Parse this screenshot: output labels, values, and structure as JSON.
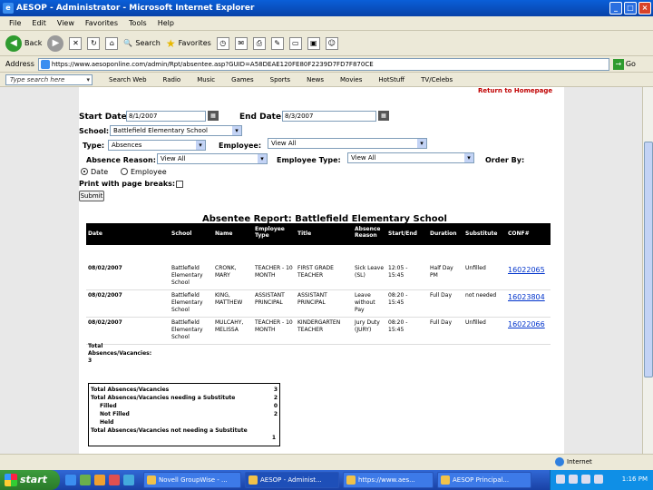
{
  "window": {
    "title": "AESOP - Administrator - Microsoft Internet Explorer"
  },
  "menu": [
    "File",
    "Edit",
    "View",
    "Favorites",
    "Tools",
    "Help"
  ],
  "toolbar": {
    "back": "Back",
    "search": "Search",
    "favorites": "Favorites"
  },
  "address": {
    "label": "Address",
    "url": "https://www.aesoponline.com/admin/Rpt/absentee.asp?GUID=A58DEAE120FE80F2239D7FD7F870CE",
    "go": "Go"
  },
  "links": {
    "search_placeholder": "Type search here",
    "items": [
      "Search Web",
      "Radio",
      "Music",
      "Games",
      "Sports",
      "News",
      "Movies",
      "HotStuff",
      "TV/Celebs"
    ]
  },
  "page": {
    "return_link": "Return to Homepage",
    "form": {
      "start_date_label": "Start Date:",
      "start_date": "8/1/2007",
      "end_date_label": "End Date:",
      "end_date": "8/3/2007",
      "school_label": "School:",
      "school": "Battlefield Elementary School",
      "type_label": "Type:",
      "type": "Absences",
      "employee_label": "Employee:",
      "employee": "View All",
      "absence_reason_label": "Absence Reason:",
      "absence_reason": "View All",
      "employee_type_label": "Employee Type:",
      "employee_type": "View All",
      "order_by_label": "Order By:",
      "order_date": "Date",
      "order_employee": "Employee",
      "print_label": "Print with page breaks:",
      "submit": "Submit"
    },
    "report": {
      "title": "Absentee Report: Battlefield Elementary School",
      "headers": [
        "Date",
        "School",
        "Name",
        "Employee Type",
        "Title",
        "Absence Reason",
        "Start/End",
        "Duration",
        "Substitute",
        "CONF#"
      ],
      "rows": [
        {
          "date": "08/02/2007",
          "school": "Battlefield Elementary School",
          "name": "CRONK, MARY",
          "emp_type": "TEACHER - 10 MONTH",
          "title": "FIRST GRADE TEACHER",
          "reason": "Sick Leave (SL)",
          "time": "12:05 - 15:45",
          "duration": "Half Day PM",
          "sub": "Unfilled",
          "conf": "16022065"
        },
        {
          "date": "08/02/2007",
          "school": "Battlefield Elementary School",
          "name": "KING, MATTHEW",
          "emp_type": "ASSISTANT PRINCIPAL",
          "title": "ASSISTANT PRINCIPAL",
          "reason": "Leave without Pay",
          "time": "08:20 - 15:45",
          "duration": "Full Day",
          "sub": "not needed",
          "conf": "16023804"
        },
        {
          "date": "08/02/2007",
          "school": "Battlefield Elementary School",
          "name": "MULCAHY, MELISSA",
          "emp_type": "TEACHER - 10 MONTH",
          "title": "KINDERGARTEN TEACHER",
          "reason": "Jury Duty (JURY)",
          "time": "08:20 - 15:45",
          "duration": "Full Day",
          "sub": "Unfilled",
          "conf": "16022066"
        }
      ],
      "total_label": "Total Absences/Vacancies:",
      "total_value": "3",
      "summary": [
        {
          "label": "Total Absences/Vacancies",
          "value": "3"
        },
        {
          "label": "Total Absences/Vacancies needing a Substitute",
          "value": "2"
        },
        {
          "label": "Filled",
          "value": "0"
        },
        {
          "label": "Not Filled",
          "value": "2"
        },
        {
          "label": "Held",
          "value": ""
        },
        {
          "label": "Total Absences/Vacancies not needing a Substitute",
          "value": "1"
        }
      ]
    }
  },
  "status": {
    "zone": "Internet"
  },
  "taskbar": {
    "start": "start",
    "tasks": [
      "Novell GroupWise - ...",
      "AESOP - Administ...",
      "https://www.aes...",
      "AESOP Principal..."
    ],
    "clock": "1:16 PM"
  }
}
